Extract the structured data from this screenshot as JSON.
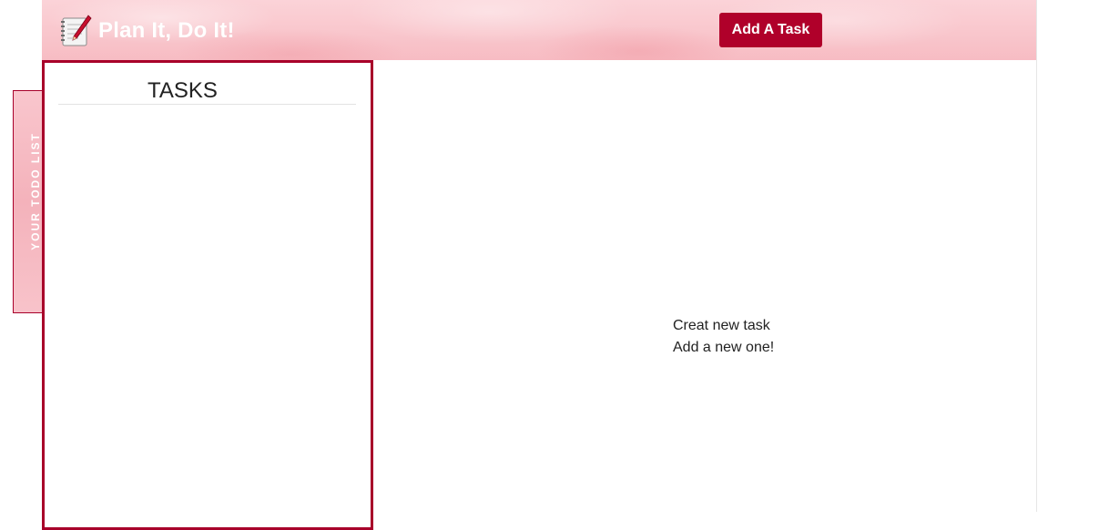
{
  "header": {
    "title": "Plan It, Do It!",
    "logo_icon": "notepad-pencil-icon",
    "add_task_label": "Add A Task",
    "background_color": "#f7bcc3",
    "accent_color": "#b0002a"
  },
  "tasks_panel": {
    "heading": "TASKS",
    "border_color": "#a8002a",
    "items": []
  },
  "side_tab": {
    "label": "YOUR TODO LIST"
  },
  "main": {
    "empty_title": "Creat new task",
    "empty_subtitle": "Add a new one!"
  }
}
